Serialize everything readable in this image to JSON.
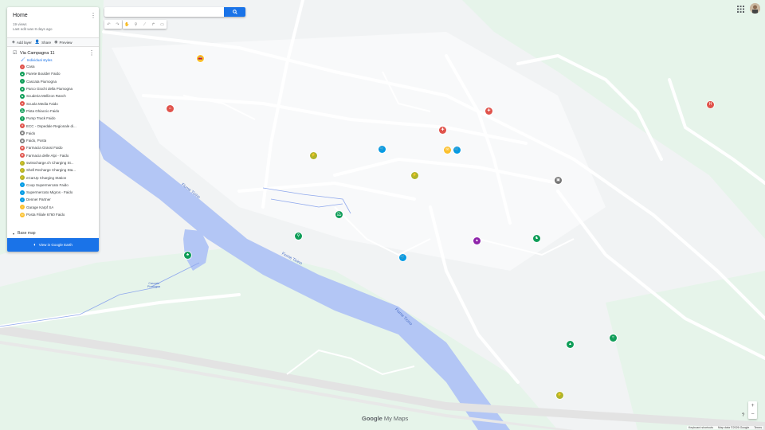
{
  "colors": {
    "primary": "#1a73e8",
    "river": "#b3c6f5",
    "park": "#d4f0db",
    "road": "#ffffff",
    "land": "#f1f3f4"
  },
  "panel": {
    "title": "Home",
    "views": "19 views",
    "last_edit": "Last edit was 8 days ago",
    "actions": [
      {
        "label": "Add layer",
        "icon": "add-layer-icon"
      },
      {
        "label": "Share",
        "icon": "share-icon"
      },
      {
        "label": "Preview",
        "icon": "eye-icon"
      }
    ],
    "layer": {
      "name": "Via Campagna 11",
      "style_link": "Individual styles",
      "places": [
        {
          "label": "Casa",
          "color": "#e0534b",
          "icon": "home-icon"
        },
        {
          "label": "Parete Boulder Faido",
          "color": "#0f9d58",
          "icon": "climbing-icon"
        },
        {
          "label": "Cascata Piumogna",
          "color": "#0f9d58",
          "icon": "waterfall-icon"
        },
        {
          "label": "Parco Giochi della Piumogna",
          "color": "#0f9d58",
          "icon": "playground-icon"
        },
        {
          "label": "Scuderia Mellizon Ranch",
          "color": "#0f9d58",
          "icon": "horse-icon"
        },
        {
          "label": "Scuola Media Faido",
          "color": "#e0534b",
          "icon": "school-icon"
        },
        {
          "label": "Pista Ghiaccio Faido",
          "color": "#0f9d58",
          "icon": "skating-icon"
        },
        {
          "label": "Pump Track Faido",
          "color": "#0f9d58",
          "icon": "bike-icon"
        },
        {
          "label": "ECC - Ospedale Regionale di...",
          "color": "#e0534b",
          "icon": "hospital-icon"
        },
        {
          "label": "Faido",
          "color": "#757575",
          "icon": "train-icon"
        },
        {
          "label": "Faido, Posta",
          "color": "#757575",
          "icon": "bus-icon"
        },
        {
          "label": "Farmacia Grassi Faido",
          "color": "#e0534b",
          "icon": "pharmacy-icon"
        },
        {
          "label": "Farmacia delle Alpi - Faido",
          "color": "#e0534b",
          "icon": "pharmacy-icon"
        },
        {
          "label": "swisscharge.ch Charging St...",
          "color": "#afb42b",
          "icon": "charging-icon"
        },
        {
          "label": "Shell Recharge Charging Sta...",
          "color": "#afb42b",
          "icon": "charging-icon"
        },
        {
          "label": "eCarUp Charging Station",
          "color": "#afb42b",
          "icon": "charging-icon"
        },
        {
          "label": "Coop Supermercato Faido",
          "color": "#039be5",
          "icon": "cart-icon"
        },
        {
          "label": "Supermercato Migros - Faido",
          "color": "#039be5",
          "icon": "cart-icon"
        },
        {
          "label": "Denner Partner",
          "color": "#039be5",
          "icon": "cart-icon"
        },
        {
          "label": "Garage Karpf SA",
          "color": "#fbc02d",
          "icon": "car-icon"
        },
        {
          "label": "Posta Filiale 6760 Faido",
          "color": "#fbc02d",
          "icon": "mail-icon"
        }
      ]
    },
    "base_map": "Base map",
    "earth_button": "View in Google Earth"
  },
  "search": {
    "placeholder": "",
    "value": ""
  },
  "map": {
    "river_labels": [
      "Fiume Ticino",
      "Fiume Ticino",
      "Fiume Ticino"
    ],
    "small_label": "Cascata Piumogna",
    "markers": [
      {
        "icon": "car-icon",
        "color": "#fbc02d"
      },
      {
        "icon": "home-icon",
        "color": "#e0534b"
      },
      {
        "icon": "pharmacy-icon",
        "color": "#e0534b"
      },
      {
        "icon": "pharmacy-icon",
        "color": "#e0534b"
      },
      {
        "icon": "hospital-icon",
        "color": "#e0534b"
      },
      {
        "icon": "cart-icon",
        "color": "#039be5"
      },
      {
        "icon": "cart-icon",
        "color": "#039be5"
      },
      {
        "icon": "cart-icon",
        "color": "#039be5"
      },
      {
        "icon": "mail-icon",
        "color": "#fbc02d"
      },
      {
        "icon": "charging-icon",
        "color": "#afb42b"
      },
      {
        "icon": "charging-icon",
        "color": "#afb42b"
      },
      {
        "icon": "charging-icon",
        "color": "#afb42b"
      },
      {
        "icon": "bus-icon",
        "color": "#757575"
      },
      {
        "icon": "skating-icon",
        "color": "#0f9d58"
      },
      {
        "icon": "bike-icon",
        "color": "#0f9d58"
      },
      {
        "icon": "school-icon",
        "color": "#8e24aa"
      },
      {
        "icon": "horse-icon",
        "color": "#0f9d58"
      },
      {
        "icon": "playground-icon",
        "color": "#0f9d58"
      },
      {
        "icon": "climbing-icon",
        "color": "#0f9d58"
      },
      {
        "icon": "waterfall-icon",
        "color": "#0f9d58"
      }
    ]
  },
  "branding": {
    "google": "Google",
    "mymaps": "My Maps"
  },
  "footer": {
    "shortcuts": "Keyboard shortcuts",
    "mapdata": "Map data ©2026 Google",
    "terms": "Terms"
  },
  "zoom": {
    "plus": "+",
    "minus": "−"
  },
  "help": "?"
}
